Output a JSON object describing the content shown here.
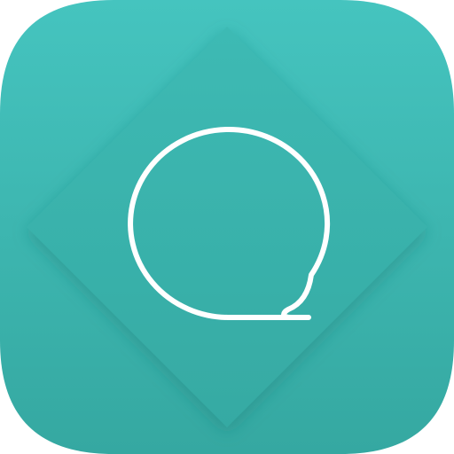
{
  "icon": {
    "name": "speech-bubble-app-icon",
    "glyph": "speech-bubble-outline-icon",
    "colors": {
      "tile_top": "#45c4bf",
      "tile_bottom": "#35a8a1",
      "diamond_top": "#3dbab4",
      "diamond_bottom": "#36aaa3",
      "shadow": "#1f7f7a",
      "glyph_stroke": "#ffffff"
    }
  }
}
